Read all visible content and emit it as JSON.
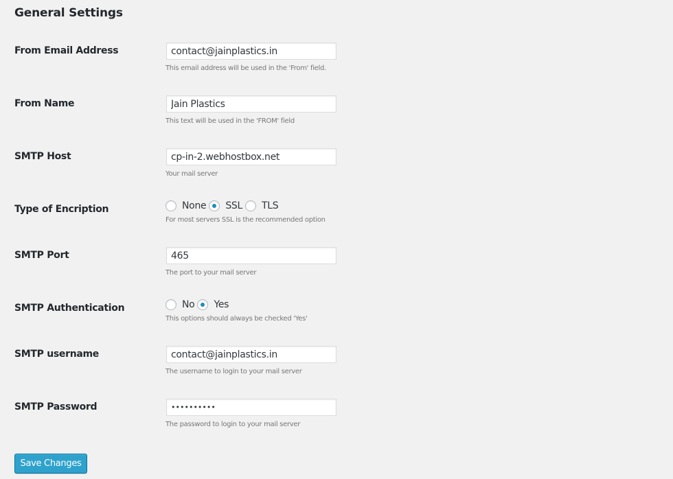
{
  "page": {
    "title": "General Settings"
  },
  "fields": {
    "from_email": {
      "label": "From Email Address",
      "value": "contact@jainplastics.in",
      "description": "This email address will be used in the 'From' field."
    },
    "from_name": {
      "label": "From Name",
      "value": "Jain Plastics",
      "description": "This text will be used in the 'FROM' field"
    },
    "smtp_host": {
      "label": "SMTP Host",
      "value": "cp-in-2.webhostbox.net",
      "description": "Your mail server"
    },
    "encryption": {
      "label": "Type of Encription",
      "options": [
        {
          "label": "None",
          "checked": false
        },
        {
          "label": "SSL",
          "checked": true
        },
        {
          "label": "TLS",
          "checked": false
        }
      ],
      "selected": "SSL",
      "description": "For most servers SSL is the recommended option"
    },
    "smtp_port": {
      "label": "SMTP Port",
      "value": "465",
      "description": "The port to your mail server"
    },
    "smtp_auth": {
      "label": "SMTP Authentication",
      "options": [
        {
          "label": "No",
          "checked": false
        },
        {
          "label": "Yes",
          "checked": true
        }
      ],
      "selected": "Yes",
      "description": "This options should always be checked 'Yes'"
    },
    "smtp_username": {
      "label": "SMTP username",
      "value": "contact@jainplastics.in",
      "description": "The username to login to your mail server"
    },
    "smtp_password": {
      "label": "SMTP Password",
      "value": "••••••••••",
      "description": "The password to login to your mail server"
    }
  },
  "actions": {
    "save_label": "Save Changes"
  },
  "colors": {
    "background": "#f1f1f1",
    "primary_button": "#2ea2cc",
    "radio_checked": "#1e8cbe"
  }
}
